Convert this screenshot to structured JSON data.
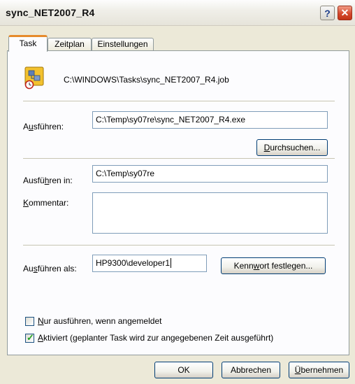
{
  "window": {
    "title": "sync_NET2007_R4",
    "help_label": "?",
    "close_label": "✕"
  },
  "tabs": [
    {
      "label": "Task",
      "active": true
    },
    {
      "label": "Zeitplan",
      "active": false
    },
    {
      "label": "Einstellungen",
      "active": false
    }
  ],
  "task": {
    "icon": "scheduled-task-icon",
    "path": "C:\\WINDOWS\\Tasks\\sync_NET2007_R4.job",
    "run_label": "Ausführen:",
    "run_value": "C:\\Temp\\sy07re\\sync_NET2007_R4.exe",
    "browse_label": "Durchsuchen...",
    "start_in_label": "Ausführen in:",
    "start_in_value": "C:\\Temp\\sy07re",
    "comment_label": "Kommentar:",
    "comment_value": "",
    "run_as_label": "Ausführen als:",
    "run_as_value": "HP9300\\developer1",
    "set_password_label": "Kennwort festlegen...",
    "only_logged_on_label": "Nur ausführen, wenn angemeldet",
    "only_logged_on_checked": false,
    "enabled_label": "Aktiviert (geplanter Task wird zur angegebenen Zeit ausgeführt)",
    "enabled_checked": true
  },
  "footer": {
    "ok_label": "OK",
    "cancel_label": "Abbrechen",
    "apply_label": "Übernehmen"
  },
  "colors": {
    "tab_accent": "#e68b2c",
    "close_button": "#d5492d",
    "check_mark": "#21a121",
    "field_border": "#7f9db9"
  }
}
